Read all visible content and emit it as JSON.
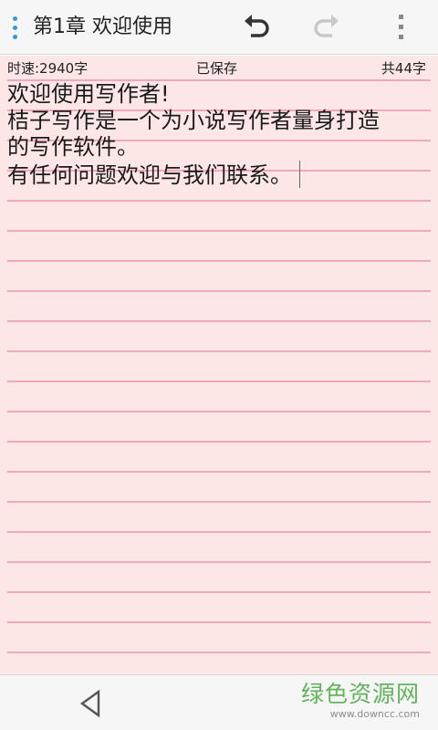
{
  "toolbar": {
    "title": "第1章 欢迎使用",
    "icons": {
      "drawer": "drawer-toggle-icon",
      "undo": "undo-icon",
      "redo": "redo-icon",
      "more": "more-vert-icon"
    },
    "redo_enabled": false
  },
  "status": {
    "speed": "时速:2940字",
    "save_state": "已保存",
    "char_count": "共44字"
  },
  "editor": {
    "lines": [
      "欢迎使用写作者!",
      "桔子写作是一个为小说写作者量身打造",
      "的写作软件。",
      "有任何问题欢迎与我们联系。"
    ]
  },
  "navbar": {
    "icons": {
      "back": "back-triangle-icon"
    }
  },
  "watermark": {
    "main": "绿色资源网",
    "url": "www.downcc.com"
  },
  "colors": {
    "accent": "#3a95d6",
    "paper": "#fce6e6",
    "rule_line": "#f0a8bc",
    "text": "#1a1a1a",
    "watermark_green": "#62b35a"
  }
}
